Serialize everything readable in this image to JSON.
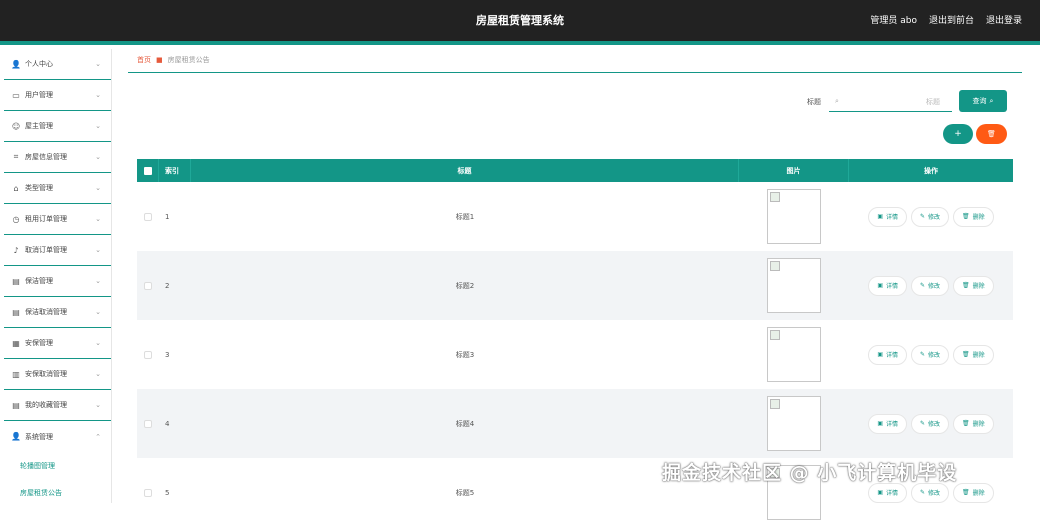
{
  "header": {
    "title": "房屋租赁管理系统",
    "admin": "管理员 abo",
    "to_front": "退出到前台",
    "logout": "退出登录"
  },
  "sidebar": {
    "items": [
      {
        "label": "个人中心",
        "icon": "person-icon"
      },
      {
        "label": "用户管理",
        "icon": "card-icon"
      },
      {
        "label": "屋主管理",
        "icon": "smile-icon"
      },
      {
        "label": "房屋信息管理",
        "icon": "crop-icon"
      },
      {
        "label": "类型管理",
        "icon": "bank-icon"
      },
      {
        "label": "租用订单管理",
        "icon": "clock-icon"
      },
      {
        "label": "取消订单管理",
        "icon": "mic-icon"
      },
      {
        "label": "保洁管理",
        "icon": "clipboard-icon"
      },
      {
        "label": "保洁取消管理",
        "icon": "clipboard-icon"
      },
      {
        "label": "安保管理",
        "icon": "grid-icon"
      },
      {
        "label": "安保取消管理",
        "icon": "chart-icon"
      },
      {
        "label": "我的收藏管理",
        "icon": "list-icon"
      },
      {
        "label": "系统管理",
        "icon": "person-icon"
      }
    ],
    "sub_items": [
      {
        "label": "轮播图管理"
      },
      {
        "label": "房屋租赁公告"
      }
    ]
  },
  "breadcrumb": {
    "home": "首页",
    "current": "房屋租赁公告"
  },
  "search": {
    "label": "标题",
    "placeholder": "标题",
    "query_button": "查询"
  },
  "actions": {
    "add": "+",
    "delete": "🗑"
  },
  "table": {
    "headers": {
      "index": "索引",
      "title": "标题",
      "image": "图片",
      "operations": "操作"
    },
    "rows": [
      {
        "index": "1",
        "title": "标题1"
      },
      {
        "index": "2",
        "title": "标题2"
      },
      {
        "index": "3",
        "title": "标题3"
      },
      {
        "index": "4",
        "title": "标题4"
      },
      {
        "index": "5",
        "title": "标题5"
      }
    ],
    "op_labels": {
      "detail": "详情",
      "edit": "修改",
      "remove": "删除"
    }
  },
  "watermark": "掘金技术社区 @ 小飞计算机毕设",
  "colors": {
    "accent": "#139687",
    "danger": "#ff5a14",
    "topbar": "#222222"
  }
}
